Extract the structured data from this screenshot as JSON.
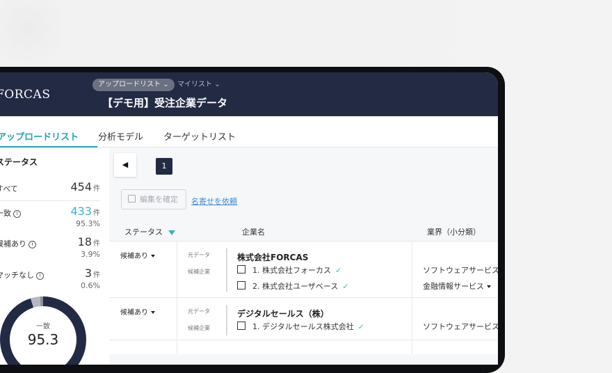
{
  "header": {
    "logo": "FORCAS",
    "breadcrumb_active": "アップロードリスト",
    "breadcrumb_other": "マイリスト",
    "title": "【デモ用】受注企業データ"
  },
  "tabs": [
    {
      "label": "アップロードリスト"
    },
    {
      "label": "分析モデル"
    },
    {
      "label": "ターゲットリスト"
    }
  ],
  "sidebar": {
    "title": "ステータス",
    "items": [
      {
        "label": "すべて",
        "count": "454",
        "unit": "件",
        "pct": ""
      },
      {
        "label": "一致",
        "count": "433",
        "unit": "件",
        "pct": "95.3%"
      },
      {
        "label": "候補あり",
        "count": "18",
        "unit": "件",
        "pct": "3.9%"
      },
      {
        "label": "マッチなし",
        "count": "3",
        "unit": "件",
        "pct": "0.6%"
      }
    ],
    "donut": {
      "label": "一致",
      "value": "95.3",
      "fraction": 0.953,
      "color": "#232a44"
    }
  },
  "toolbar": {
    "page": "1",
    "edit_label": "編集を確定",
    "request_link": "名寄せを依頼"
  },
  "table": {
    "headers": {
      "status": "ステータス",
      "company": "企業名",
      "industry": "業界（小分類）"
    },
    "rows": [
      {
        "status": "候補あり",
        "source_tag": "元データ",
        "candidate_tag": "候補企業",
        "company": "株式会社FORCAS",
        "candidates": [
          "1. 株式会社フォーカス",
          "2. 株式会社ユーザベース"
        ],
        "industries": [
          "ソフトウェアサービス",
          "金融情報サービス"
        ]
      },
      {
        "status": "候補あり",
        "source_tag": "元データ",
        "candidate_tag": "候補企業",
        "company": "デジタルセールス（株）",
        "candidates": [
          "1. デジタルセールス株式会社"
        ],
        "industries": [
          "ソフトウェアサービス"
        ]
      }
    ]
  },
  "colors": {
    "accent": "#1aa7b0",
    "navy": "#232a44",
    "link": "#3d8bd1"
  }
}
